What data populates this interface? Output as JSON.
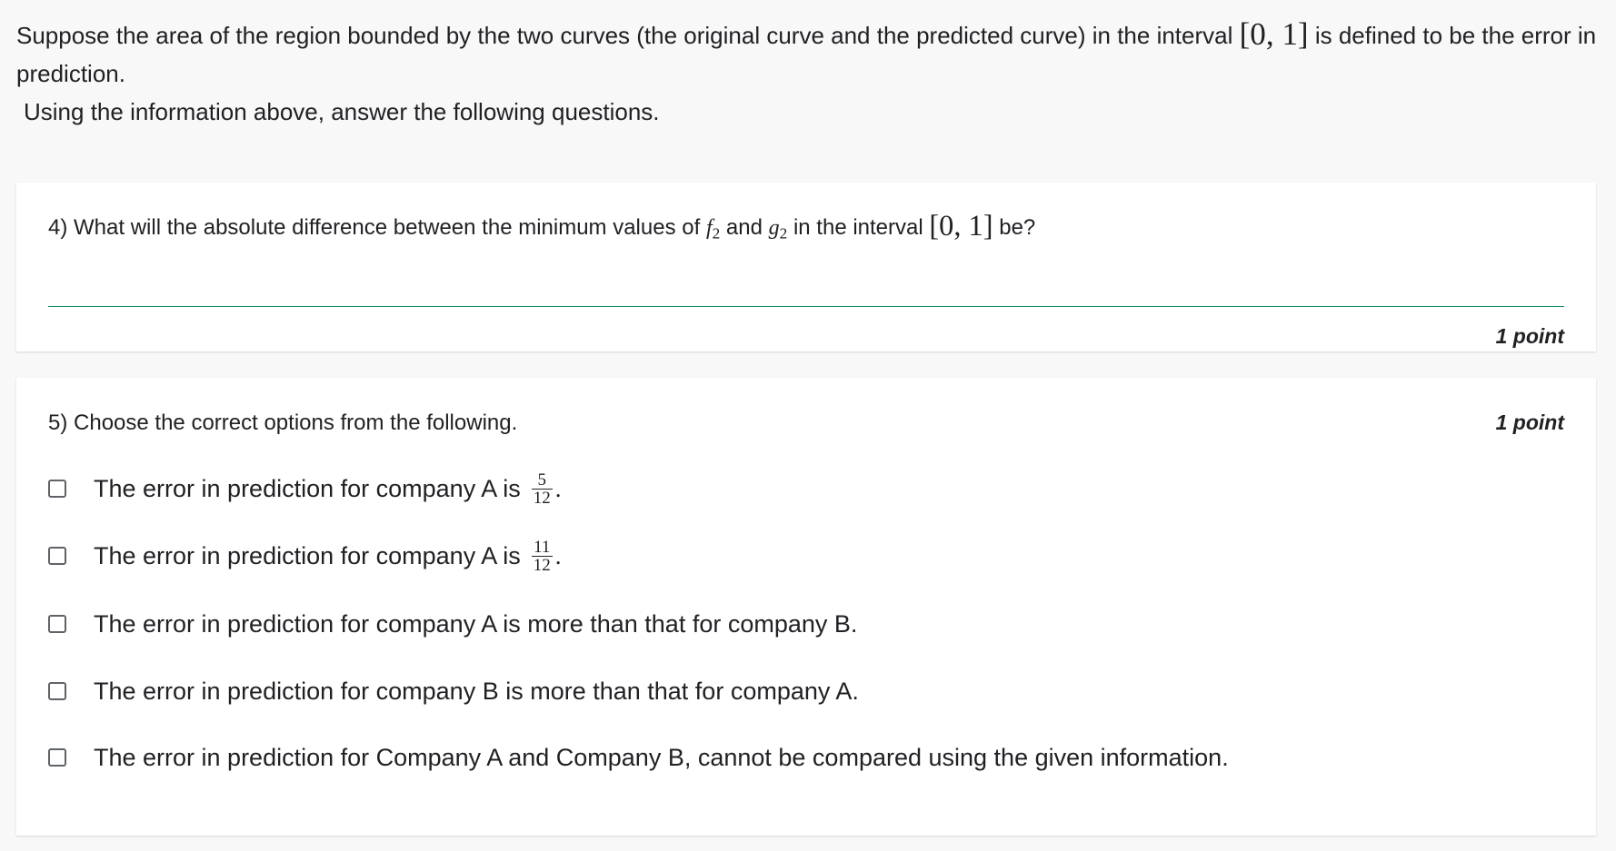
{
  "intro": {
    "line1_prefix": "Suppose the area of the region bounded by the two curves (the original curve and the predicted curve) in the interval",
    "line1_interval": "[0, 1]",
    "line1_suffix": "is defined to be the error in prediction.",
    "line2": "Using the information above, answer the following questions."
  },
  "question4": {
    "number": "4)",
    "text_a": "What will the absolute difference between the minimum values of",
    "f": "f",
    "f_sub": "2",
    "and": "and",
    "g": "g",
    "g_sub": "2",
    "text_b": "in the interval",
    "interval": "[0, 1]",
    "text_c": "be?",
    "answer_value": "",
    "points": "1 point"
  },
  "question5": {
    "number": "5)",
    "text": "Choose the correct options from the following.",
    "points": "1 point",
    "options": [
      {
        "text": "The error in prediction for company A is",
        "frac_num": "5",
        "frac_den": "12",
        "suffix": "."
      },
      {
        "text": "The error in prediction for company A is",
        "frac_num": "11",
        "frac_den": "12",
        "suffix": "."
      },
      {
        "text": "The error in prediction for company A is more than that for company B."
      },
      {
        "text": "The error in prediction for company B is more than that for company A."
      },
      {
        "text": "The error in prediction for Company A and Company B, cannot be compared using the given information."
      }
    ]
  }
}
